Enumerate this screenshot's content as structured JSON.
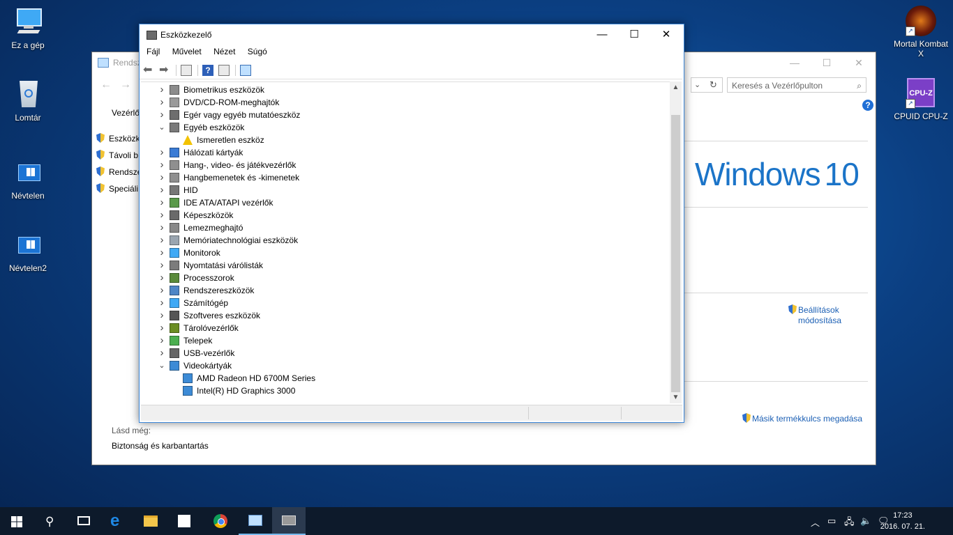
{
  "desktop": {
    "icons_left": [
      {
        "label": "Ez a gép",
        "icon": "computer-icon"
      },
      {
        "label": "Lomtár",
        "icon": "recycle-bin-icon"
      },
      {
        "label": "Névtelen",
        "icon": "windows-file-icon"
      },
      {
        "label": "Névtelen2",
        "icon": "windows-file-icon"
      }
    ],
    "icons_right": [
      {
        "label": "Mortal Kombat X",
        "icon": "mortal-kombat-icon"
      },
      {
        "label": "CPUID CPU-Z",
        "icon": "cpuz-icon"
      }
    ]
  },
  "control_panel": {
    "title": "Rendszer",
    "search_placeholder": "Keresés a Vezérlőpulton",
    "breadcrumb": "Vezérlőp",
    "left_links": [
      "Eszközk",
      "Távoli b",
      "Rendsze",
      "Speciáli"
    ],
    "logo": "Windows",
    "logo_ver": "10",
    "settings_link_1": "Beállítások",
    "settings_link_2": "módosítása",
    "product_key_link": "Másik termékkulcs megadása",
    "see_also": "Lásd még:",
    "security_link": "Biztonság és karbantartás"
  },
  "device_manager": {
    "title": "Eszközkezelő",
    "menu": [
      "Fájl",
      "Művelet",
      "Nézet",
      "Súgó"
    ],
    "tree": [
      {
        "label": "Biometrikus eszközök",
        "level": 0,
        "expand": "collapsed",
        "icon": "fingerprint-icon"
      },
      {
        "label": "DVD/CD-ROM-meghajtók",
        "level": 0,
        "expand": "collapsed",
        "icon": "dvd-drive-icon"
      },
      {
        "label": "Egér vagy egyéb mutatóeszköz",
        "level": 0,
        "expand": "collapsed",
        "icon": "mouse-icon"
      },
      {
        "label": "Egyéb eszközök",
        "level": 0,
        "expand": "expanded",
        "icon": "unknown-devices-icon"
      },
      {
        "label": "Ismeretlen eszköz",
        "level": 1,
        "expand": "none",
        "icon": "warning-device-icon"
      },
      {
        "label": "Hálózati kártyák",
        "level": 0,
        "expand": "collapsed",
        "icon": "network-adapter-icon"
      },
      {
        "label": "Hang-, video- és játékvezérlők",
        "level": 0,
        "expand": "collapsed",
        "icon": "speaker-icon"
      },
      {
        "label": "Hangbemenetek és -kimenetek",
        "level": 0,
        "expand": "collapsed",
        "icon": "speaker-icon"
      },
      {
        "label": "HID",
        "level": 0,
        "expand": "collapsed",
        "icon": "keyboard-icon"
      },
      {
        "label": "IDE ATA/ATAPI vezérlők",
        "level": 0,
        "expand": "collapsed",
        "icon": "ide-controller-icon"
      },
      {
        "label": "Képeszközök",
        "level": 0,
        "expand": "collapsed",
        "icon": "camera-icon"
      },
      {
        "label": "Lemezmeghajtó",
        "level": 0,
        "expand": "collapsed",
        "icon": "disk-drive-icon"
      },
      {
        "label": "Memóriatechnológiai eszközök",
        "level": 0,
        "expand": "collapsed",
        "icon": "memory-icon"
      },
      {
        "label": "Monitorok",
        "level": 0,
        "expand": "collapsed",
        "icon": "monitor-icon"
      },
      {
        "label": "Nyomtatási várólisták",
        "level": 0,
        "expand": "collapsed",
        "icon": "printer-icon"
      },
      {
        "label": "Processzorok",
        "level": 0,
        "expand": "collapsed",
        "icon": "processor-icon"
      },
      {
        "label": "Rendszereszközök",
        "level": 0,
        "expand": "collapsed",
        "icon": "system-device-icon"
      },
      {
        "label": "Számítógép",
        "level": 0,
        "expand": "collapsed",
        "icon": "computer-icon"
      },
      {
        "label": "Szoftveres eszközök",
        "level": 0,
        "expand": "collapsed",
        "icon": "software-device-icon"
      },
      {
        "label": "Tárolóvezérlők",
        "level": 0,
        "expand": "collapsed",
        "icon": "storage-controller-icon"
      },
      {
        "label": "Telepek",
        "level": 0,
        "expand": "collapsed",
        "icon": "battery-icon"
      },
      {
        "label": "USB-vezérlők",
        "level": 0,
        "expand": "collapsed",
        "icon": "usb-icon"
      },
      {
        "label": "Videokártyák",
        "level": 0,
        "expand": "expanded",
        "icon": "display-adapter-icon"
      },
      {
        "label": "AMD Radeon HD 6700M Series",
        "level": 1,
        "expand": "none",
        "icon": "display-adapter-icon"
      },
      {
        "label": "Intel(R) HD Graphics 3000",
        "level": 1,
        "expand": "none",
        "icon": "display-adapter-icon"
      }
    ]
  },
  "taskbar": {
    "time": "17:23",
    "date": "2016. 07. 21."
  }
}
